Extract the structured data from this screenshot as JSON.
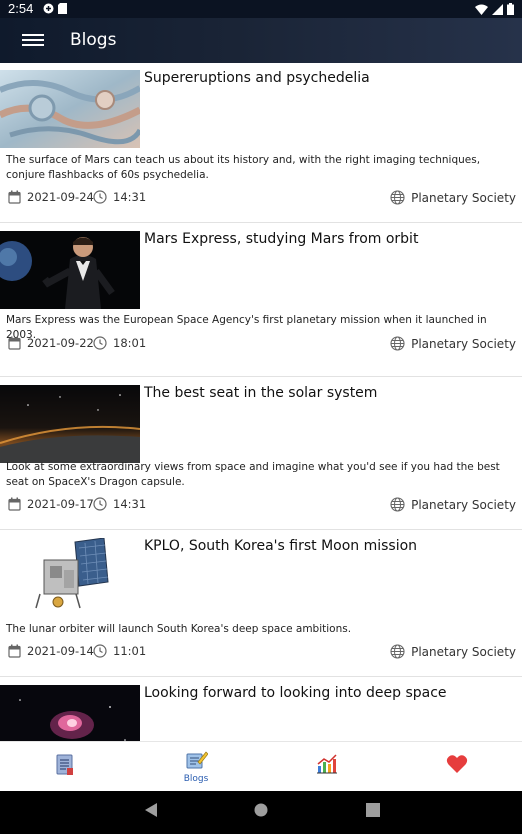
{
  "status_bar": {
    "time": "2:54"
  },
  "app_bar": {
    "title": "Blogs"
  },
  "posts": [
    {
      "title": "Supereruptions and psychedelia",
      "description": "The surface of Mars can teach us about its history and, with the right imaging techniques, conjure flashbacks of 60s psychedelia.",
      "date": "2021-09-24",
      "time": "14:31",
      "source": "Planetary Society"
    },
    {
      "title": "Mars Express, studying Mars from orbit",
      "description": "Mars Express was the European Space Agency's first planetary mission when it launched in 2003.",
      "date": "2021-09-22",
      "time": "18:01",
      "source": "Planetary Society"
    },
    {
      "title": "The best seat in the solar system",
      "description": "Look at some extraordinary views from space and imagine what you'd see if you had the best seat on SpaceX's Dragon capsule.",
      "date": "2021-09-17",
      "time": "14:31",
      "source": "Planetary Society"
    },
    {
      "title": "KPLO, South Korea's first Moon mission",
      "description": "The lunar orbiter will launch South Korea's deep space ambitions.",
      "date": "2021-09-14",
      "time": "11:01",
      "source": "Planetary Society"
    },
    {
      "title": "Looking forward to looking into deep space"
    }
  ],
  "bottom_nav": {
    "items": [
      {
        "icon": "document-icon",
        "label": ""
      },
      {
        "icon": "blogs-icon",
        "label": "Blogs",
        "selected": true
      },
      {
        "icon": "chart-icon",
        "label": ""
      },
      {
        "icon": "heart-icon",
        "label": ""
      }
    ]
  }
}
